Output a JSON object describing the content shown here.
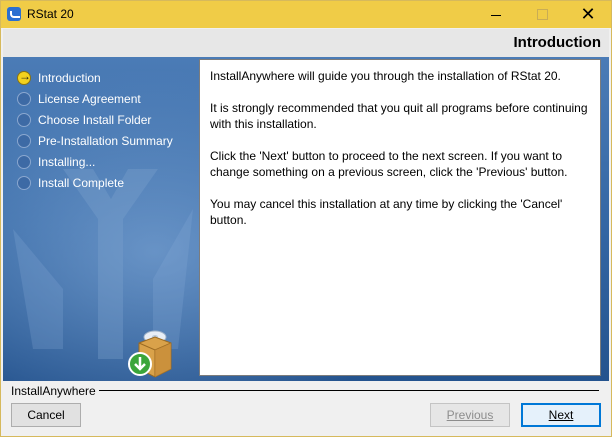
{
  "window": {
    "title": "RStat 20",
    "controls": {
      "minimize_icon": "minimize-icon",
      "maximize_icon": "maximize-icon",
      "close_icon": "close-icon"
    }
  },
  "header": {
    "title": "Introduction"
  },
  "steps": [
    {
      "label": "Introduction",
      "active": true
    },
    {
      "label": "License Agreement",
      "active": false
    },
    {
      "label": "Choose Install Folder",
      "active": false
    },
    {
      "label": "Pre-Installation Summary",
      "active": false
    },
    {
      "label": "Installing...",
      "active": false
    },
    {
      "label": "Install Complete",
      "active": false
    }
  ],
  "content": {
    "paragraphs": [
      "InstallAnywhere will guide you through the installation of RStat 20.",
      "It is strongly recommended that you quit all programs before continuing with this installation.",
      "Click the 'Next' button to proceed to the next screen. If you want to change something on a previous screen, click the 'Previous' button.",
      "You may cancel this installation at any time by clicking the 'Cancel' button."
    ]
  },
  "footer": {
    "brand": "InstallAnywhere",
    "cancel_label": "Cancel",
    "previous_label": "Previous",
    "next_label": "Next"
  },
  "colors": {
    "titlebar": "#f0cc47",
    "sidebar_bg": "#2b5a93",
    "active_step": "#f3d21e",
    "next_focus": "#0078d7"
  }
}
